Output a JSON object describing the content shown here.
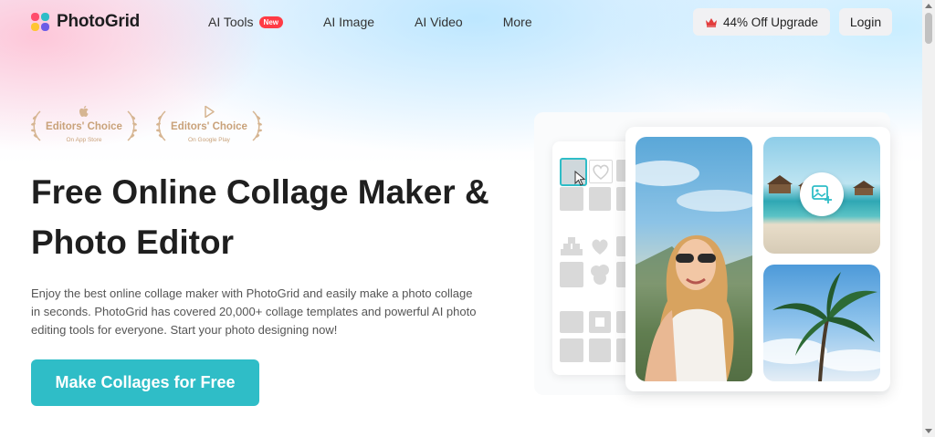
{
  "header": {
    "logo_text": "PhotoGrid",
    "nav": [
      {
        "label": "AI Tools",
        "badge": "New"
      },
      {
        "label": "AI Image"
      },
      {
        "label": "AI Video"
      },
      {
        "label": "More"
      }
    ],
    "upgrade_label": "44% Off Upgrade",
    "login_label": "Login"
  },
  "awards": [
    {
      "title": "Editors' Choice",
      "subtitle": "On App Store",
      "icon": "apple-icon"
    },
    {
      "title": "Editors' Choice",
      "subtitle": "On Google Play",
      "icon": "google-play-icon"
    }
  ],
  "hero": {
    "title_line1": "Free Online Collage Maker &",
    "title_line2": "Photo Editor",
    "description": "Enjoy the best online collage maker with PhotoGrid and easily make a photo collage in seconds. PhotoGrid has covered 20,000+ collage templates and powerful AI photo editing tools for everyone. Start your photo designing now!",
    "cta_label": "Make Collages for Free"
  },
  "colors": {
    "accent": "#2fbdc7",
    "badge_red": "#ff3b45",
    "award_gold": "#c9a27a"
  }
}
